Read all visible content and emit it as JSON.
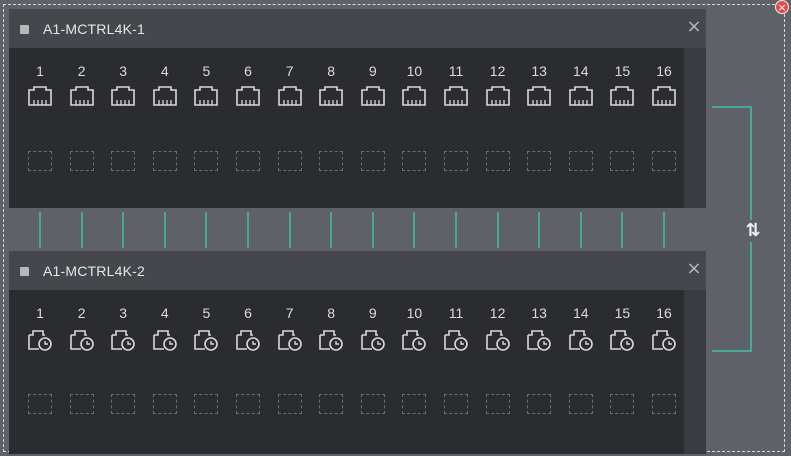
{
  "window": {
    "close_symbol": "×"
  },
  "devices": [
    {
      "name": "A1-MCTRL4K-1",
      "close_symbol": "×",
      "port_type": "rj45-port-icon",
      "ports": [
        "1",
        "2",
        "3",
        "4",
        "5",
        "6",
        "7",
        "8",
        "9",
        "10",
        "11",
        "12",
        "13",
        "14",
        "15",
        "16"
      ]
    },
    {
      "name": "A1-MCTRL4K-2",
      "close_symbol": "×",
      "port_type": "port-history-icon",
      "ports": [
        "1",
        "2",
        "3",
        "4",
        "5",
        "6",
        "7",
        "8",
        "9",
        "10",
        "11",
        "12",
        "13",
        "14",
        "15",
        "16"
      ]
    }
  ],
  "connections": {
    "accent_color": "#4aa89a",
    "swap_symbol": "⇅"
  },
  "colors": {
    "background": "#5e6167",
    "panel": "#2b2c30",
    "panel_header": "#45474d"
  }
}
